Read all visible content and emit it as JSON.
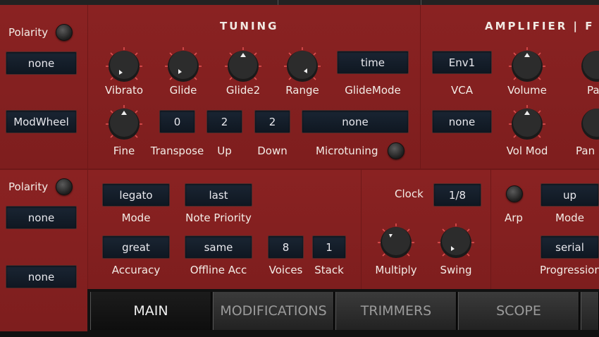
{
  "sections": {
    "tuning": "TUNING",
    "amplifier": "AMPLIFIER | F"
  },
  "left": {
    "polarity1": "Polarity",
    "none1": "none",
    "modwheel": "ModWheel",
    "polarity2": "Polarity",
    "none2": "none",
    "none3": "none"
  },
  "tuning": {
    "vibrato": "Vibrato",
    "glide": "Glide",
    "glide2": "Glide2",
    "range": "Range",
    "glidemode_value": "time",
    "glidemode": "GlideMode",
    "fine": "Fine",
    "transpose_value": "0",
    "transpose": "Transpose",
    "up_value": "2",
    "up": "Up",
    "down_value": "2",
    "down": "Down",
    "microtuning_value": "none",
    "microtuning": "Microtuning"
  },
  "amplifier": {
    "vca_value": "Env1",
    "vca": "VCA",
    "volume": "Volume",
    "pan_top": "Pa",
    "vca2_value": "none",
    "volmod": "Vol Mod",
    "pan": "Pan"
  },
  "voice": {
    "mode_value": "legato",
    "mode": "Mode",
    "priority_value": "last",
    "priority": "Note Priority",
    "accuracy_value": "great",
    "accuracy": "Accuracy",
    "offline_value": "same",
    "offline": "Offline Acc",
    "voices_value": "8",
    "voices": "Voices",
    "stack_value": "1",
    "stack": "Stack"
  },
  "clock": {
    "label": "Clock",
    "value": "1/8",
    "multiply": "Multiply",
    "swing": "Swing"
  },
  "arp": {
    "arp": "Arp",
    "mode_value": "up",
    "mode": "Mode",
    "progression_value": "serial",
    "progression": "Progression"
  },
  "tabs": [
    "MAIN",
    "MODIFICATIONS",
    "TRIMMERS",
    "SCOPE"
  ],
  "active_tab": "MAIN"
}
